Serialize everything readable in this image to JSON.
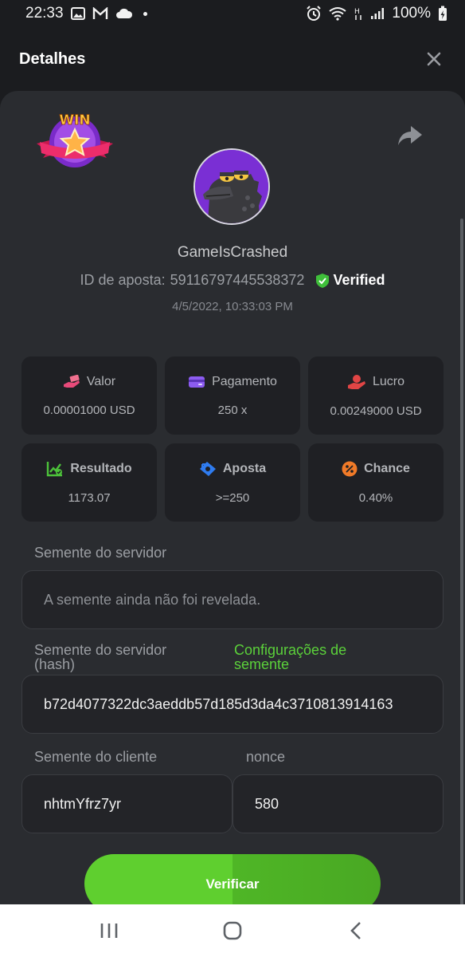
{
  "status_bar": {
    "time": "22:33",
    "battery": "100%"
  },
  "header": {
    "title": "Detalhes"
  },
  "profile": {
    "username": "GameIsCrashed",
    "bet_id_label": "ID de aposta:",
    "bet_id_value": "59116797445538372",
    "verified_label": "Verified",
    "datetime": "4/5/2022, 10:33:03 PM",
    "win_badge_text": "WIN"
  },
  "stats": [
    {
      "label": "Valor",
      "value": "0.00001000 USD",
      "icon": "money-hand-icon",
      "color": "#e84a7a"
    },
    {
      "label": "Pagamento",
      "value": "250 x",
      "icon": "wallet-card-icon",
      "color": "#8c5cf0"
    },
    {
      "label": "Lucro",
      "value": "0.00249000 USD",
      "icon": "profit-hand-icon",
      "color": "#e04545"
    },
    {
      "label": "Resultado",
      "value": "1173.07",
      "icon": "chart-check-icon",
      "color": "#4cc23a"
    },
    {
      "label": "Aposta",
      "value": ">=250",
      "icon": "ticket-icon",
      "color": "#2f7cf0"
    },
    {
      "label": "Chance",
      "value": "0.40%",
      "icon": "percent-icon",
      "color": "#f07a28"
    }
  ],
  "server_seed": {
    "label": "Semente do servidor",
    "value": "A semente ainda não foi revelada."
  },
  "server_hash": {
    "label_line1": "Semente do servidor",
    "label_line2": "(hash)",
    "link_line1": "Configurações de",
    "link_line2": "semente",
    "value": "b72d4077322dc3aeddb57d185d3da4c3710813914163"
  },
  "client_seed": {
    "label": "Semente do cliente",
    "value": "nhtmYfrz7yr"
  },
  "nonce": {
    "label": "nonce",
    "value": "580"
  },
  "verify_button": {
    "label": "Verificar"
  },
  "colors": {
    "accent_green": "#5bd13a",
    "panel": "#2a2c30",
    "background": "#1b1c1f"
  }
}
